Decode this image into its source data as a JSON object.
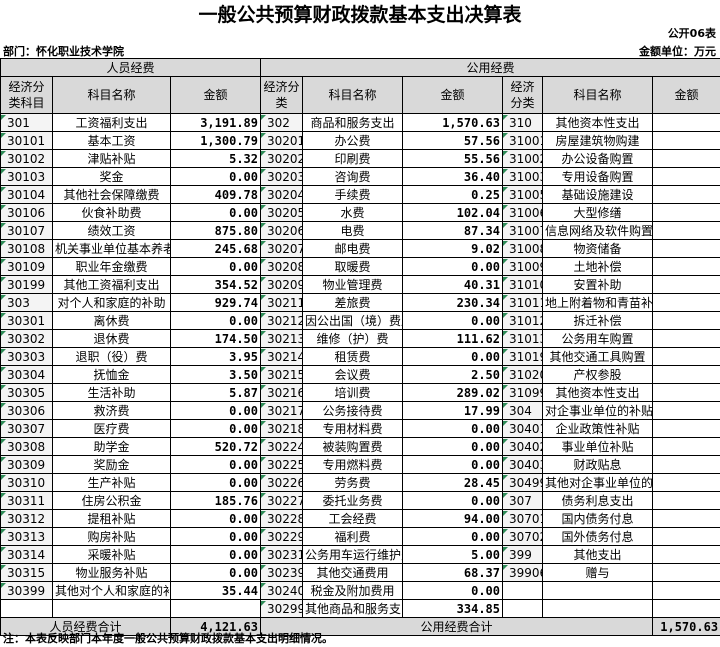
{
  "title": "一般公共预算财政拨款基本支出决算表",
  "code_no": "公开06表",
  "dept": "部门：怀化职业技术学院",
  "unit": "金额单位：万元",
  "headers": {
    "personnel": "人员经费",
    "public": "公用经费",
    "econ_class": "经济分类科目",
    "econ": "经济分类",
    "econ_right": "经济分类",
    "subject": "科目名称",
    "amount": "金额"
  },
  "rows": [
    {
      "c1": "301",
      "n1": "工资福利支出",
      "a1": "3,191.89",
      "c2": "302",
      "n2": "商品和服务支出",
      "a2": "1,570.63",
      "c3": "310",
      "n3": "其他资本性支出",
      "a3": ""
    },
    {
      "c1": "30101",
      "n1": "基本工资",
      "a1": "1,300.79",
      "c2": "30201",
      "n2": "办公费",
      "a2": "57.56",
      "c3": "31001",
      "n3": "房屋建筑物购建",
      "a3": ""
    },
    {
      "c1": "30102",
      "n1": "津贴补贴",
      "a1": "5.32",
      "c2": "30202",
      "n2": "印刷费",
      "a2": "55.56",
      "c3": "31002",
      "n3": "办公设备购置",
      "a3": ""
    },
    {
      "c1": "30103",
      "n1": "奖金",
      "a1": "0.00",
      "c2": "30203",
      "n2": "咨询费",
      "a2": "36.40",
      "c3": "31003",
      "n3": "专用设备购置",
      "a3": ""
    },
    {
      "c1": "30104",
      "n1": "其他社会保障缴费",
      "a1": "409.78",
      "c2": "30204",
      "n2": "手续费",
      "a2": "0.25",
      "c3": "31005",
      "n3": "基础设施建设",
      "a3": ""
    },
    {
      "c1": "30106",
      "n1": "伙食补助费",
      "a1": "0.00",
      "c2": "30205",
      "n2": "水费",
      "a2": "102.04",
      "c3": "31006",
      "n3": "大型修缮",
      "a3": ""
    },
    {
      "c1": "30107",
      "n1": "绩效工资",
      "a1": "875.80",
      "c2": "30206",
      "n2": "电费",
      "a2": "87.34",
      "c3": "31007",
      "n3": "信息网络及软件购置更新",
      "a3": ""
    },
    {
      "c1": "30108",
      "n1": "机关事业单位基本养老保险缴费",
      "a1": "245.68",
      "c2": "30207",
      "n2": "邮电费",
      "a2": "9.02",
      "c3": "31008",
      "n3": "物资储备",
      "a3": ""
    },
    {
      "c1": "30109",
      "n1": "职业年金缴费",
      "a1": "0.00",
      "c2": "30208",
      "n2": "取暖费",
      "a2": "0.00",
      "c3": "31009",
      "n3": "土地补偿",
      "a3": ""
    },
    {
      "c1": "30199",
      "n1": "其他工资福利支出",
      "a1": "354.52",
      "c2": "30209",
      "n2": "物业管理费",
      "a2": "40.31",
      "c3": "31010",
      "n3": "安置补助",
      "a3": ""
    },
    {
      "c1": "303",
      "n1": "对个人和家庭的补助",
      "a1": "929.74",
      "c2": "30211",
      "n2": "差旅费",
      "a2": "230.34",
      "c3": "31011",
      "n3": "地上附着物和青苗补偿",
      "a3": ""
    },
    {
      "c1": "30301",
      "n1": "离休费",
      "a1": "0.00",
      "c2": "30212",
      "n2": "因公出国（境）费用",
      "a2": "0.00",
      "c3": "31012",
      "n3": "拆迁补偿",
      "a3": ""
    },
    {
      "c1": "30302",
      "n1": "退休费",
      "a1": "174.50",
      "c2": "30213",
      "n2": "维修（护）费",
      "a2": "111.62",
      "c3": "31013",
      "n3": "公务用车购置",
      "a3": ""
    },
    {
      "c1": "30303",
      "n1": "退职（役）费",
      "a1": "3.95",
      "c2": "30214",
      "n2": "租赁费",
      "a2": "0.00",
      "c3": "31019",
      "n3": "其他交通工具购置",
      "a3": ""
    },
    {
      "c1": "30304",
      "n1": "抚恤金",
      "a1": "3.50",
      "c2": "30215",
      "n2": "会议费",
      "a2": "2.50",
      "c3": "31020",
      "n3": "产权参股",
      "a3": ""
    },
    {
      "c1": "30305",
      "n1": "生活补助",
      "a1": "5.87",
      "c2": "30216",
      "n2": "培训费",
      "a2": "289.02",
      "c3": "31099",
      "n3": "其他资本性支出",
      "a3": ""
    },
    {
      "c1": "30306",
      "n1": "救济费",
      "a1": "0.00",
      "c2": "30217",
      "n2": "公务接待费",
      "a2": "17.99",
      "c3": "304",
      "n3": "对企事业单位的补贴",
      "a3": ""
    },
    {
      "c1": "30307",
      "n1": "医疗费",
      "a1": "0.00",
      "c2": "30218",
      "n2": "专用材料费",
      "a2": "0.00",
      "c3": "30401",
      "n3": "企业政策性补贴",
      "a3": ""
    },
    {
      "c1": "30308",
      "n1": "助学金",
      "a1": "520.72",
      "c2": "30224",
      "n2": "被装购置费",
      "a2": "0.00",
      "c3": "30402",
      "n3": "事业单位补贴",
      "a3": ""
    },
    {
      "c1": "30309",
      "n1": "奖励金",
      "a1": "0.00",
      "c2": "30225",
      "n2": "专用燃料费",
      "a2": "0.00",
      "c3": "30403",
      "n3": "财政贴息",
      "a3": ""
    },
    {
      "c1": "30310",
      "n1": "生产补贴",
      "a1": "0.00",
      "c2": "30226",
      "n2": "劳务费",
      "a2": "28.45",
      "c3": "30499",
      "n3": "其他对企事业单位的补贴",
      "a3": ""
    },
    {
      "c1": "30311",
      "n1": "住房公积金",
      "a1": "185.76",
      "c2": "30227",
      "n2": "委托业务费",
      "a2": "0.00",
      "c3": "307",
      "n3": "债务利息支出",
      "a3": ""
    },
    {
      "c1": "30312",
      "n1": "提租补贴",
      "a1": "0.00",
      "c2": "30228",
      "n2": "工会经费",
      "a2": "94.00",
      "c3": "30701",
      "n3": "国内债务付息",
      "a3": ""
    },
    {
      "c1": "30313",
      "n1": "购房补贴",
      "a1": "0.00",
      "c2": "30229",
      "n2": "福利费",
      "a2": "0.00",
      "c3": "30702",
      "n3": "国外债务付息",
      "a3": ""
    },
    {
      "c1": "30314",
      "n1": "采暖补贴",
      "a1": "0.00",
      "c2": "30231",
      "n2": "公务用车运行维护费",
      "a2": "5.00",
      "c3": "399",
      "n3": "其他支出",
      "a3": ""
    },
    {
      "c1": "30315",
      "n1": "物业服务补贴",
      "a1": "0.00",
      "c2": "30239",
      "n2": "其他交通费用",
      "a2": "68.37",
      "c3": "39906",
      "n3": "赠与",
      "a3": ""
    },
    {
      "c1": "30399",
      "n1": "其他对个人和家庭的补助支出",
      "a1": "35.44",
      "c2": "30240",
      "n2": "税金及附加费用",
      "a2": "0.00",
      "c3": "",
      "n3": "",
      "a3": ""
    },
    {
      "c1": "",
      "n1": "",
      "a1": "",
      "c2": "30299",
      "n2": "其他商品和服务支出",
      "a2": "334.85",
      "c3": "",
      "n3": "",
      "a3": ""
    }
  ],
  "totals": {
    "personnel_label": "人员经费合计",
    "personnel_value": "4,121.63",
    "public_label": "公用经费合计",
    "public_value": "1,570.63"
  },
  "note": "注：本表反映部门本年度一般公共预算财政拨款基本支出明细情况。"
}
